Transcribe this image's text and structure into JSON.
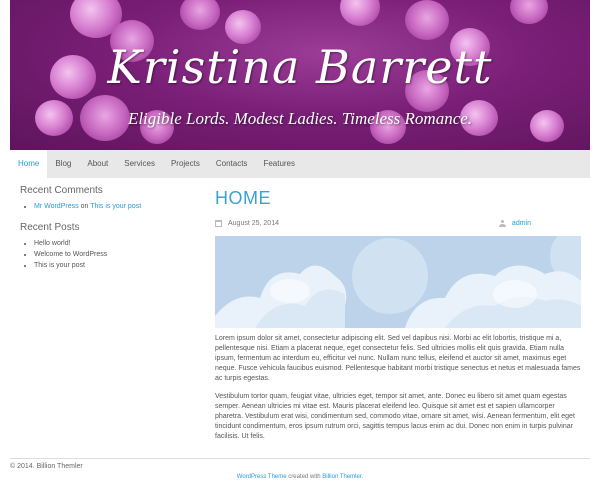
{
  "header": {
    "site_title": "Kristina Barrett",
    "tagline": "Eligible Lords. Modest Ladies. Timeless Romance."
  },
  "nav": {
    "items": [
      "Home",
      "Blog",
      "About",
      "Services",
      "Projects",
      "Contacts",
      "Features"
    ],
    "active": "Home"
  },
  "sidebar": {
    "recent_comments": {
      "title": "Recent Comments",
      "items": [
        {
          "author": "Mr WordPress",
          "connector": "on",
          "post": "This is your post"
        }
      ]
    },
    "recent_posts": {
      "title": "Recent Posts",
      "items": [
        "Hello world!",
        "Welcome to WordPress",
        "This is your post"
      ]
    }
  },
  "main": {
    "page_title": "HOME",
    "date": "August 25, 2014",
    "author": "admin",
    "paragraphs": [
      "Lorem ipsum dolor sit amet, consectetur adipiscing elit. Sed vel dapibus nisi. Morbi ac elit lobortis, tristique mi a, pellentesque nisi. Etiam a placerat neque, eget consectetur felis. Sed ultricies mollis elit quis gravida. Etiam nulla ipsum, fermentum ac interdum eu, efficitur vel nunc. Nullam nunc tellus, eleifend et auctor sit amet, maximus eget neque. Fusce vehicula faucibus euismod. Pellentesque habitant morbi tristique senectus et netus et malesuada fames ac turpis egestas.",
      "Vestibulum tortor quam, feugiat vitae, ultricies eget, tempor sit amet, ante. Donec eu libero sit amet quam egestas semper. Aenean ultricies mi vitae est. Mauris placerat eleifend leo. Quisque sit amet est et sapien ullamcorper pharetra. Vestibulum erat wisi, condimentum sed, commodo vitae, ornare sit amet, wisi. Aenean fermentum, elit eget tincidunt condimentum, eros ipsum rutrum orci, sagittis tempus lacus enim ac dui. Donec non enim in turpis pulvinar facilisis. Ut felis."
    ]
  },
  "footer": {
    "copyright": "© 2014. Billion Themler",
    "credit_link1": "WordPress Theme",
    "credit_mid": " created with ",
    "credit_link2": "Billion Themler",
    "credit_end": "."
  },
  "colors": {
    "banner": "#7a1f77",
    "accent": "#2a9ad8",
    "nav_bg": "#e8e8e8"
  }
}
